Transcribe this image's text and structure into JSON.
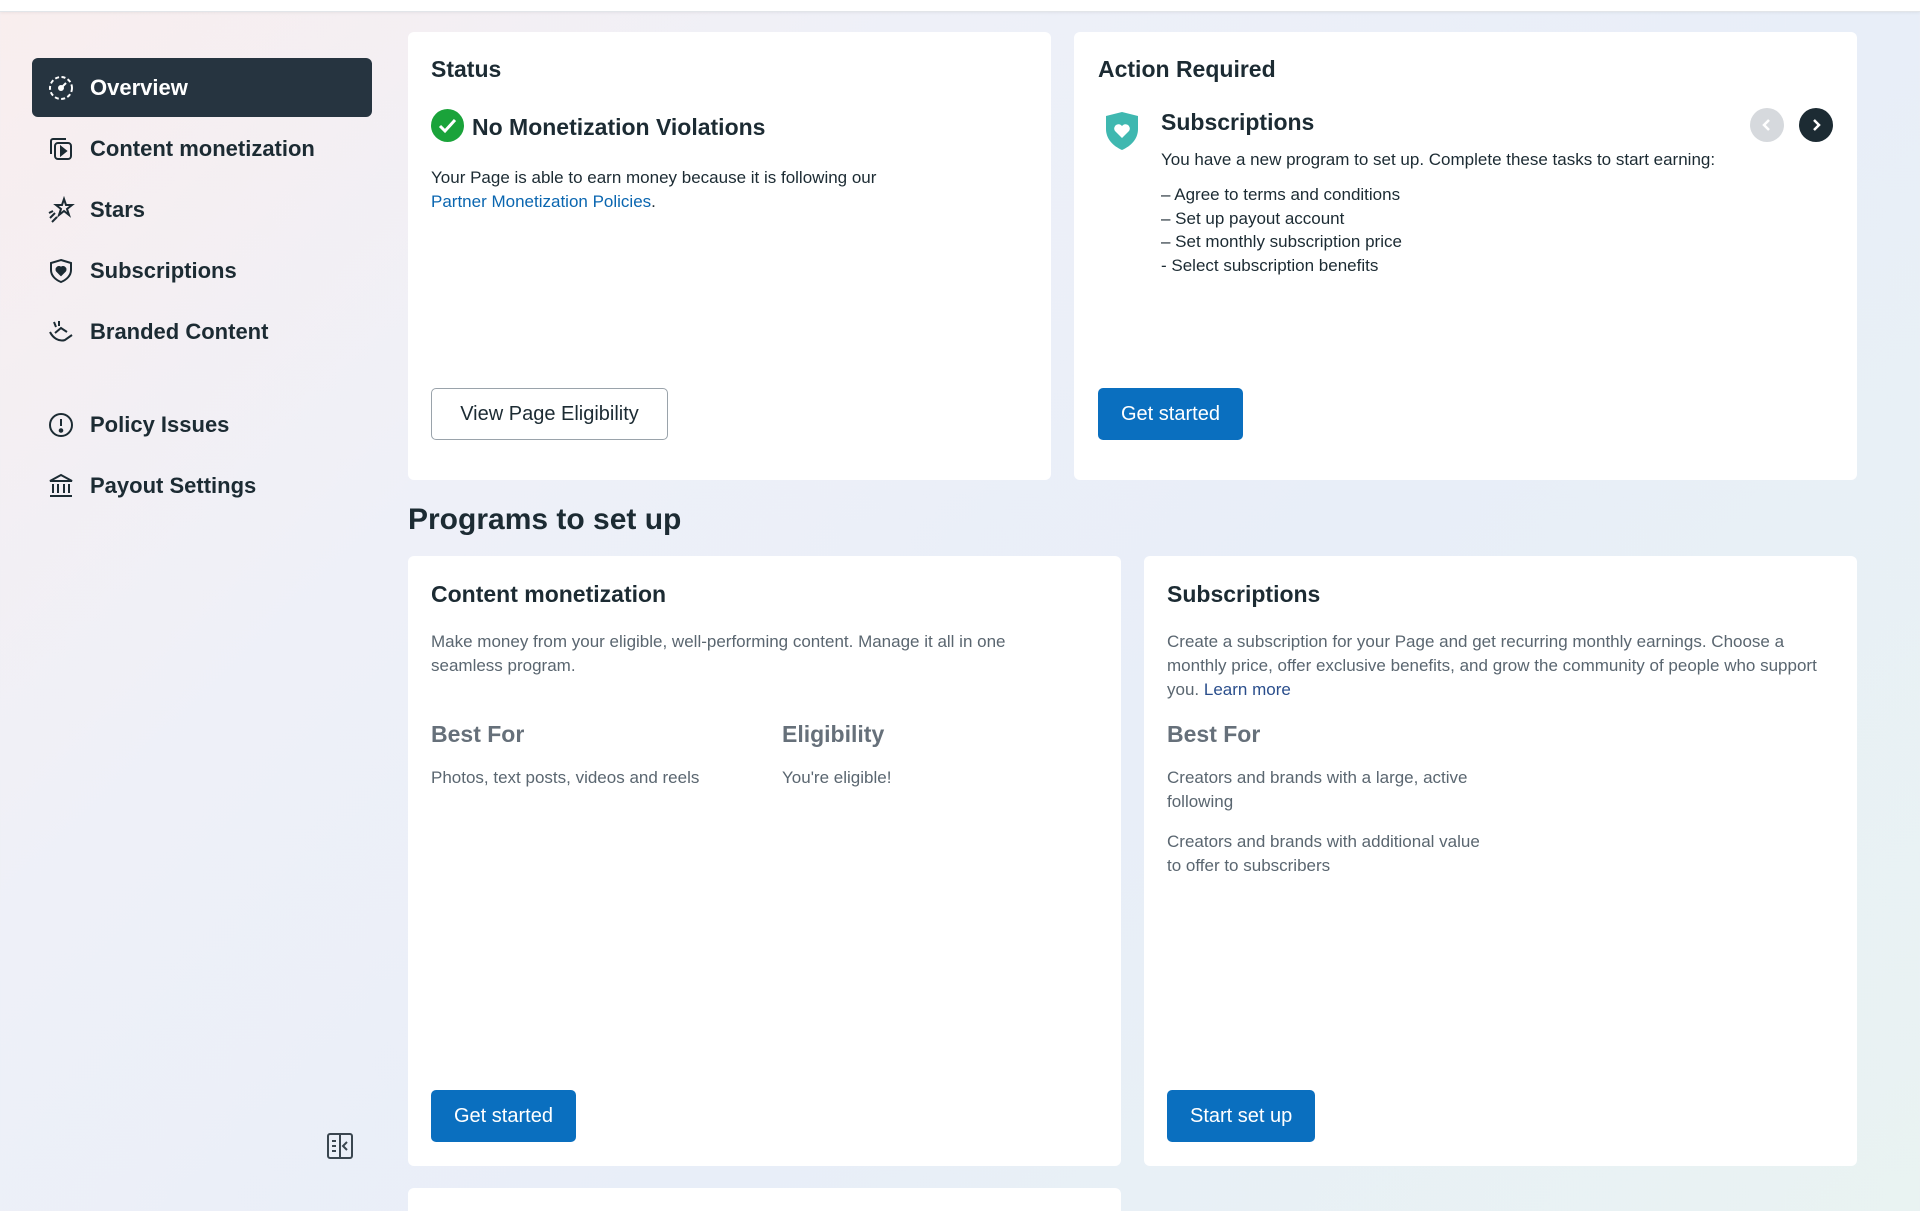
{
  "sidebar": {
    "items": [
      {
        "label": "Overview",
        "icon": "dashboard-gauge-icon",
        "active": true
      },
      {
        "label": "Content monetization",
        "icon": "play-stack-icon"
      },
      {
        "label": "Stars",
        "icon": "star-burst-icon"
      },
      {
        "label": "Subscriptions",
        "icon": "heart-shield-icon"
      },
      {
        "label": "Branded Content",
        "icon": "handshake-icon"
      },
      {
        "label": "Policy Issues",
        "icon": "alert-circle-icon"
      },
      {
        "label": "Payout Settings",
        "icon": "bank-icon"
      }
    ],
    "collapse_icon": "sidebar-collapse-icon"
  },
  "status_card": {
    "title": "Status",
    "headline": "No Monetization Violations",
    "text": "Your Page is able to earn money because it is following our",
    "link": "Partner Monetization Policies",
    "link_suffix": ".",
    "button": "View Page Eligibility"
  },
  "action_card": {
    "title": "Action Required",
    "program": "Subscriptions",
    "text": "You have a new program to set up. Complete these tasks to start earning:",
    "tasks": [
      "– Agree to terms and conditions",
      "– Set up payout account",
      "– Set monthly subscription price",
      "- Select subscription benefits"
    ],
    "button": "Get started"
  },
  "programs": {
    "title": "Programs to set up",
    "content_monetization": {
      "title": "Content monetization",
      "description": "Make money from your eligible, well-performing content. Manage it all in one seamless program.",
      "best_for_label": "Best For",
      "best_for": "Photos, text posts, videos and reels",
      "eligibility_label": "Eligibility",
      "eligibility": "You're eligible!",
      "button": "Get started"
    },
    "subscriptions": {
      "title": "Subscriptions",
      "description": "Create a subscription for your Page and get recurring monthly earnings. Choose a monthly price, offer exclusive benefits, and grow the community of people who support you.",
      "learn_more": "Learn more",
      "best_for_label": "Best For",
      "best_for_1": "Creators and brands with a large, active following",
      "best_for_2": "Creators and brands with additional value to offer to subscribers",
      "button": "Start set up"
    }
  },
  "colors": {
    "accent": "#0a6fbf",
    "success": "#1aa33a",
    "sidebar_active": "#263440",
    "subscriptions_icon": "#3fb8b0"
  }
}
